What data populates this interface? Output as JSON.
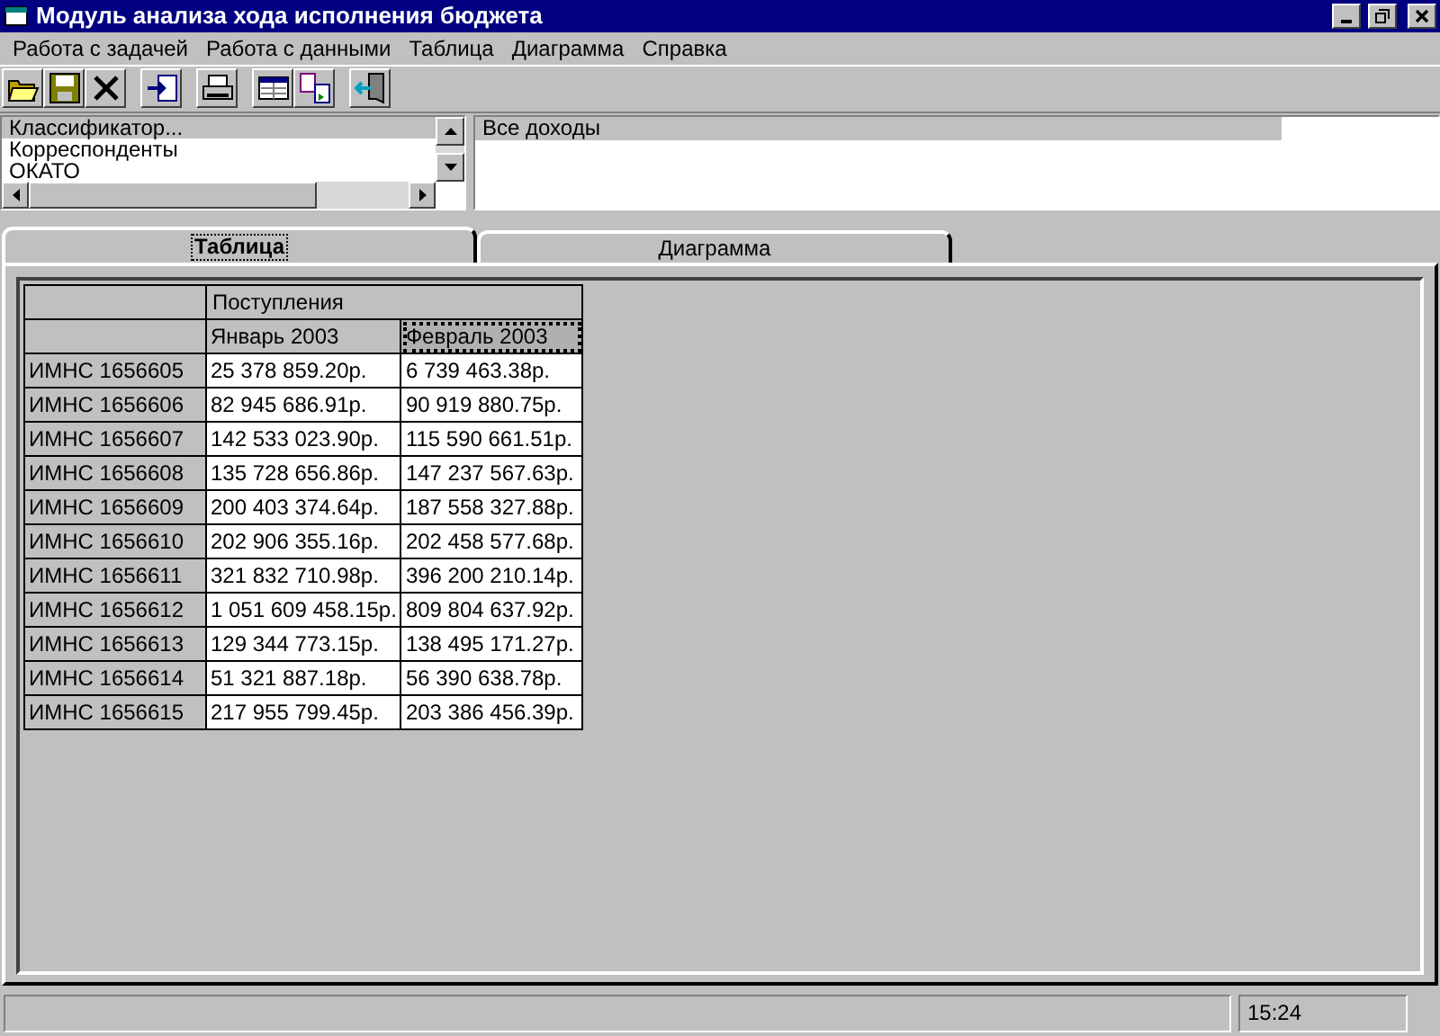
{
  "window": {
    "title": "Модуль анализа хода исполнения бюджета"
  },
  "menu": [
    "Работа с задачей",
    "Работа с данными",
    "Таблица",
    "Диаграмма",
    "Справка"
  ],
  "toolbar": [
    {
      "kind": "open"
    },
    {
      "kind": "save"
    },
    {
      "kind": "delete"
    },
    {
      "kind": "import"
    },
    {
      "kind": "print"
    },
    {
      "kind": "table"
    },
    {
      "kind": "swap"
    },
    {
      "kind": "exit"
    }
  ],
  "left_list": {
    "items": [
      {
        "label": "Классификатор...",
        "selected": true
      },
      {
        "label": "Корреспонденты",
        "selected": false
      },
      {
        "label": "ОКАТО",
        "selected": false
      }
    ]
  },
  "right_list": {
    "items": [
      {
        "label": "Все доходы",
        "selected": true
      }
    ]
  },
  "tabs": [
    {
      "label": "Таблица",
      "selected": true
    },
    {
      "label": "Диаграмма",
      "selected": false
    }
  ],
  "table": {
    "group_header": "Поступления",
    "columns": [
      {
        "label": "Январь 2003",
        "selected": false
      },
      {
        "label": "Февраль 2003",
        "selected": true
      }
    ],
    "rows": [
      {
        "name": "ИМНС 1656605",
        "values": [
          "25 378 859.20р.",
          "6 739 463.38р."
        ]
      },
      {
        "name": "ИМНС 1656606",
        "values": [
          "82 945 686.91р.",
          "90 919 880.75р."
        ]
      },
      {
        "name": "ИМНС 1656607",
        "values": [
          "142 533 023.90р.",
          "115 590 661.51р."
        ]
      },
      {
        "name": "ИМНС 1656608",
        "values": [
          "135 728 656.86р.",
          "147 237 567.63р."
        ]
      },
      {
        "name": "ИМНС 1656609",
        "values": [
          "200 403 374.64р.",
          "187 558 327.88р."
        ]
      },
      {
        "name": "ИМНС 1656610",
        "values": [
          "202 906 355.16р.",
          "202 458 577.68р."
        ]
      },
      {
        "name": "ИМНС 1656611",
        "values": [
          "321 832 710.98р.",
          "396 200 210.14р."
        ]
      },
      {
        "name": "ИМНС 1656612",
        "values": [
          "1 051 609 458.15р.",
          "809 804 637.92р."
        ]
      },
      {
        "name": "ИМНС 1656613",
        "values": [
          "129 344 773.15р.",
          "138 495 171.27р."
        ]
      },
      {
        "name": "ИМНС 1656614",
        "values": [
          "51 321 887.18р.",
          "56 390 638.78р."
        ]
      },
      {
        "name": "ИМНС 1656615",
        "values": [
          "217 955 799.45р.",
          "203 386 456.39р."
        ]
      }
    ]
  },
  "status_bar": {
    "time": "15:24"
  }
}
